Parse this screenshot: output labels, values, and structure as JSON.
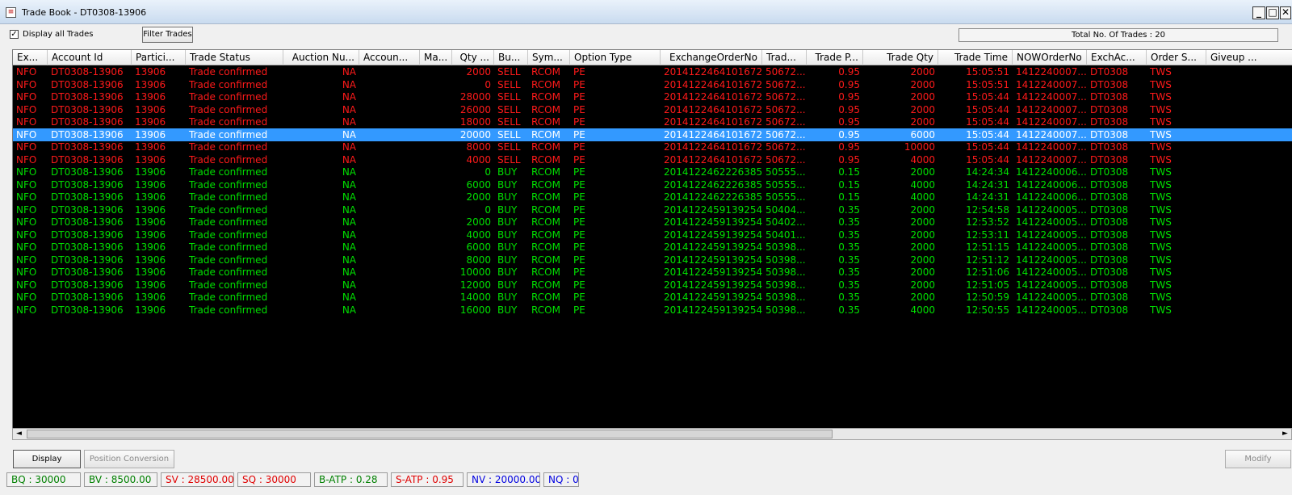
{
  "window": {
    "title": "Trade Book - DT0308-13906",
    "minimize": "_",
    "restore": "□",
    "close": "✕"
  },
  "toolbar": {
    "display_all_label": "Display all Trades",
    "display_all_checked": "✓",
    "filter_button": "Filter Trades",
    "total_trades": "Total No. Of Trades : 20"
  },
  "colors": {
    "sell": "#ff1a1a",
    "buy": "#00e000",
    "selected": "#3399ff"
  },
  "table": {
    "columns": [
      {
        "key": "ex",
        "label": "Ex...",
        "align": "l"
      },
      {
        "key": "account",
        "label": "Account Id",
        "align": "l"
      },
      {
        "key": "partici",
        "label": "Partici...",
        "align": "l"
      },
      {
        "key": "status",
        "label": "Trade Status",
        "align": "l"
      },
      {
        "key": "auction",
        "label": "Auction Nu...",
        "align": "r"
      },
      {
        "key": "accoun",
        "label": "Accoun...",
        "align": "l"
      },
      {
        "key": "ma",
        "label": "Ma...",
        "align": "l"
      },
      {
        "key": "qty",
        "label": "Qty ...",
        "align": "r"
      },
      {
        "key": "side",
        "label": "Bu...",
        "align": "l"
      },
      {
        "key": "symbol",
        "label": "Sym...",
        "align": "l"
      },
      {
        "key": "opttype",
        "label": "Option Type",
        "align": "l"
      },
      {
        "key": "exchorder",
        "label": "ExchangeOrderNo",
        "align": "r"
      },
      {
        "key": "trad",
        "label": "Trad...",
        "align": "l"
      },
      {
        "key": "price",
        "label": "Trade P...",
        "align": "r"
      },
      {
        "key": "tqty",
        "label": "Trade Qty",
        "align": "r"
      },
      {
        "key": "ttime",
        "label": "Trade Time",
        "align": "r"
      },
      {
        "key": "noworder",
        "label": "NOWOrderNo",
        "align": "l"
      },
      {
        "key": "exchac",
        "label": "ExchAc...",
        "align": "l"
      },
      {
        "key": "orders",
        "label": "Order S...",
        "align": "l"
      },
      {
        "key": "giveup",
        "label": "Giveup ...",
        "align": "l"
      }
    ],
    "rows": [
      {
        "side_color": "sell",
        "selected": false,
        "cells": [
          "NFO",
          "DT0308-13906",
          "13906",
          "Trade confirmed",
          "NA",
          "",
          "",
          "2000",
          "SELL",
          "RCOM",
          "PE",
          "2014122464101672",
          "50672...",
          "0.95",
          "2000",
          "15:05:51",
          "1412240007...",
          "DT0308",
          "TWS",
          ""
        ]
      },
      {
        "side_color": "sell",
        "selected": false,
        "cells": [
          "NFO",
          "DT0308-13906",
          "13906",
          "Trade confirmed",
          "NA",
          "",
          "",
          "0",
          "SELL",
          "RCOM",
          "PE",
          "2014122464101672",
          "50672...",
          "0.95",
          "2000",
          "15:05:51",
          "1412240007...",
          "DT0308",
          "TWS",
          ""
        ]
      },
      {
        "side_color": "sell",
        "selected": false,
        "cells": [
          "NFO",
          "DT0308-13906",
          "13906",
          "Trade confirmed",
          "NA",
          "",
          "",
          "28000",
          "SELL",
          "RCOM",
          "PE",
          "2014122464101672",
          "50672...",
          "0.95",
          "2000",
          "15:05:44",
          "1412240007...",
          "DT0308",
          "TWS",
          ""
        ]
      },
      {
        "side_color": "sell",
        "selected": false,
        "cells": [
          "NFO",
          "DT0308-13906",
          "13906",
          "Trade confirmed",
          "NA",
          "",
          "",
          "26000",
          "SELL",
          "RCOM",
          "PE",
          "2014122464101672",
          "50672...",
          "0.95",
          "2000",
          "15:05:44",
          "1412240007...",
          "DT0308",
          "TWS",
          ""
        ]
      },
      {
        "side_color": "sell",
        "selected": false,
        "cells": [
          "NFO",
          "DT0308-13906",
          "13906",
          "Trade confirmed",
          "NA",
          "",
          "",
          "18000",
          "SELL",
          "RCOM",
          "PE",
          "2014122464101672",
          "50672...",
          "0.95",
          "2000",
          "15:05:44",
          "1412240007...",
          "DT0308",
          "TWS",
          ""
        ]
      },
      {
        "side_color": "sell",
        "selected": true,
        "cells": [
          "NFO",
          "DT0308-13906",
          "13906",
          "Trade confirmed",
          "NA",
          "",
          "",
          "20000",
          "SELL",
          "RCOM",
          "PE",
          "2014122464101672",
          "50672...",
          "0.95",
          "6000",
          "15:05:44",
          "1412240007...",
          "DT0308",
          "TWS",
          ""
        ]
      },
      {
        "side_color": "sell",
        "selected": false,
        "cells": [
          "NFO",
          "DT0308-13906",
          "13906",
          "Trade confirmed",
          "NA",
          "",
          "",
          "8000",
          "SELL",
          "RCOM",
          "PE",
          "2014122464101672",
          "50672...",
          "0.95",
          "10000",
          "15:05:44",
          "1412240007...",
          "DT0308",
          "TWS",
          ""
        ]
      },
      {
        "side_color": "sell",
        "selected": false,
        "cells": [
          "NFO",
          "DT0308-13906",
          "13906",
          "Trade confirmed",
          "NA",
          "",
          "",
          "4000",
          "SELL",
          "RCOM",
          "PE",
          "2014122464101672",
          "50672...",
          "0.95",
          "4000",
          "15:05:44",
          "1412240007...",
          "DT0308",
          "TWS",
          ""
        ]
      },
      {
        "side_color": "buy",
        "selected": false,
        "cells": [
          "NFO",
          "DT0308-13906",
          "13906",
          "Trade confirmed",
          "NA",
          "",
          "",
          "0",
          "BUY",
          "RCOM",
          "PE",
          "2014122462226385",
          "50555...",
          "0.15",
          "2000",
          "14:24:34",
          "1412240006...",
          "DT0308",
          "TWS",
          ""
        ]
      },
      {
        "side_color": "buy",
        "selected": false,
        "cells": [
          "NFO",
          "DT0308-13906",
          "13906",
          "Trade confirmed",
          "NA",
          "",
          "",
          "6000",
          "BUY",
          "RCOM",
          "PE",
          "2014122462226385",
          "50555...",
          "0.15",
          "4000",
          "14:24:31",
          "1412240006...",
          "DT0308",
          "TWS",
          ""
        ]
      },
      {
        "side_color": "buy",
        "selected": false,
        "cells": [
          "NFO",
          "DT0308-13906",
          "13906",
          "Trade confirmed",
          "NA",
          "",
          "",
          "2000",
          "BUY",
          "RCOM",
          "PE",
          "2014122462226385",
          "50555...",
          "0.15",
          "4000",
          "14:24:31",
          "1412240006...",
          "DT0308",
          "TWS",
          ""
        ]
      },
      {
        "side_color": "buy",
        "selected": false,
        "cells": [
          "NFO",
          "DT0308-13906",
          "13906",
          "Trade confirmed",
          "NA",
          "",
          "",
          "0",
          "BUY",
          "RCOM",
          "PE",
          "2014122459139254",
          "50404...",
          "0.35",
          "2000",
          "12:54:58",
          "1412240005...",
          "DT0308",
          "TWS",
          ""
        ]
      },
      {
        "side_color": "buy",
        "selected": false,
        "cells": [
          "NFO",
          "DT0308-13906",
          "13906",
          "Trade confirmed",
          "NA",
          "",
          "",
          "2000",
          "BUY",
          "RCOM",
          "PE",
          "2014122459139254",
          "50402...",
          "0.35",
          "2000",
          "12:53:52",
          "1412240005...",
          "DT0308",
          "TWS",
          ""
        ]
      },
      {
        "side_color": "buy",
        "selected": false,
        "cells": [
          "NFO",
          "DT0308-13906",
          "13906",
          "Trade confirmed",
          "NA",
          "",
          "",
          "4000",
          "BUY",
          "RCOM",
          "PE",
          "2014122459139254",
          "50401...",
          "0.35",
          "2000",
          "12:53:11",
          "1412240005...",
          "DT0308",
          "TWS",
          ""
        ]
      },
      {
        "side_color": "buy",
        "selected": false,
        "cells": [
          "NFO",
          "DT0308-13906",
          "13906",
          "Trade confirmed",
          "NA",
          "",
          "",
          "6000",
          "BUY",
          "RCOM",
          "PE",
          "2014122459139254",
          "50398...",
          "0.35",
          "2000",
          "12:51:15",
          "1412240005...",
          "DT0308",
          "TWS",
          ""
        ]
      },
      {
        "side_color": "buy",
        "selected": false,
        "cells": [
          "NFO",
          "DT0308-13906",
          "13906",
          "Trade confirmed",
          "NA",
          "",
          "",
          "8000",
          "BUY",
          "RCOM",
          "PE",
          "2014122459139254",
          "50398...",
          "0.35",
          "2000",
          "12:51:12",
          "1412240005...",
          "DT0308",
          "TWS",
          ""
        ]
      },
      {
        "side_color": "buy",
        "selected": false,
        "cells": [
          "NFO",
          "DT0308-13906",
          "13906",
          "Trade confirmed",
          "NA",
          "",
          "",
          "10000",
          "BUY",
          "RCOM",
          "PE",
          "2014122459139254",
          "50398...",
          "0.35",
          "2000",
          "12:51:06",
          "1412240005...",
          "DT0308",
          "TWS",
          ""
        ]
      },
      {
        "side_color": "buy",
        "selected": false,
        "cells": [
          "NFO",
          "DT0308-13906",
          "13906",
          "Trade confirmed",
          "NA",
          "",
          "",
          "12000",
          "BUY",
          "RCOM",
          "PE",
          "2014122459139254",
          "50398...",
          "0.35",
          "2000",
          "12:51:05",
          "1412240005...",
          "DT0308",
          "TWS",
          ""
        ]
      },
      {
        "side_color": "buy",
        "selected": false,
        "cells": [
          "NFO",
          "DT0308-13906",
          "13906",
          "Trade confirmed",
          "NA",
          "",
          "",
          "14000",
          "BUY",
          "RCOM",
          "PE",
          "2014122459139254",
          "50398...",
          "0.35",
          "2000",
          "12:50:59",
          "1412240005...",
          "DT0308",
          "TWS",
          ""
        ]
      },
      {
        "side_color": "buy",
        "selected": false,
        "cells": [
          "NFO",
          "DT0308-13906",
          "13906",
          "Trade confirmed",
          "NA",
          "",
          "",
          "16000",
          "BUY",
          "RCOM",
          "PE",
          "2014122459139254",
          "50398...",
          "0.35",
          "4000",
          "12:50:55",
          "1412240005...",
          "DT0308",
          "TWS",
          ""
        ]
      }
    ]
  },
  "scrollbar": {
    "left_arrow": "◄",
    "right_arrow": "►"
  },
  "bottom": {
    "display_button": "Display",
    "position_button": "Position Conversion",
    "modify_button": "Modify"
  },
  "status": [
    {
      "label": "BQ : 30000",
      "color": "#008000"
    },
    {
      "label": "BV : 8500.00",
      "color": "#008000"
    },
    {
      "label": "SV : 28500.00",
      "color": "#e00000"
    },
    {
      "label": "SQ : 30000",
      "color": "#e00000"
    },
    {
      "label": "B-ATP : 0.28",
      "color": "#008000"
    },
    {
      "label": "S-ATP : 0.95",
      "color": "#e00000"
    },
    {
      "label": "NV : 20000.00",
      "color": "#0000e0"
    },
    {
      "label": "NQ : 0",
      "color": "#0000e0"
    }
  ]
}
